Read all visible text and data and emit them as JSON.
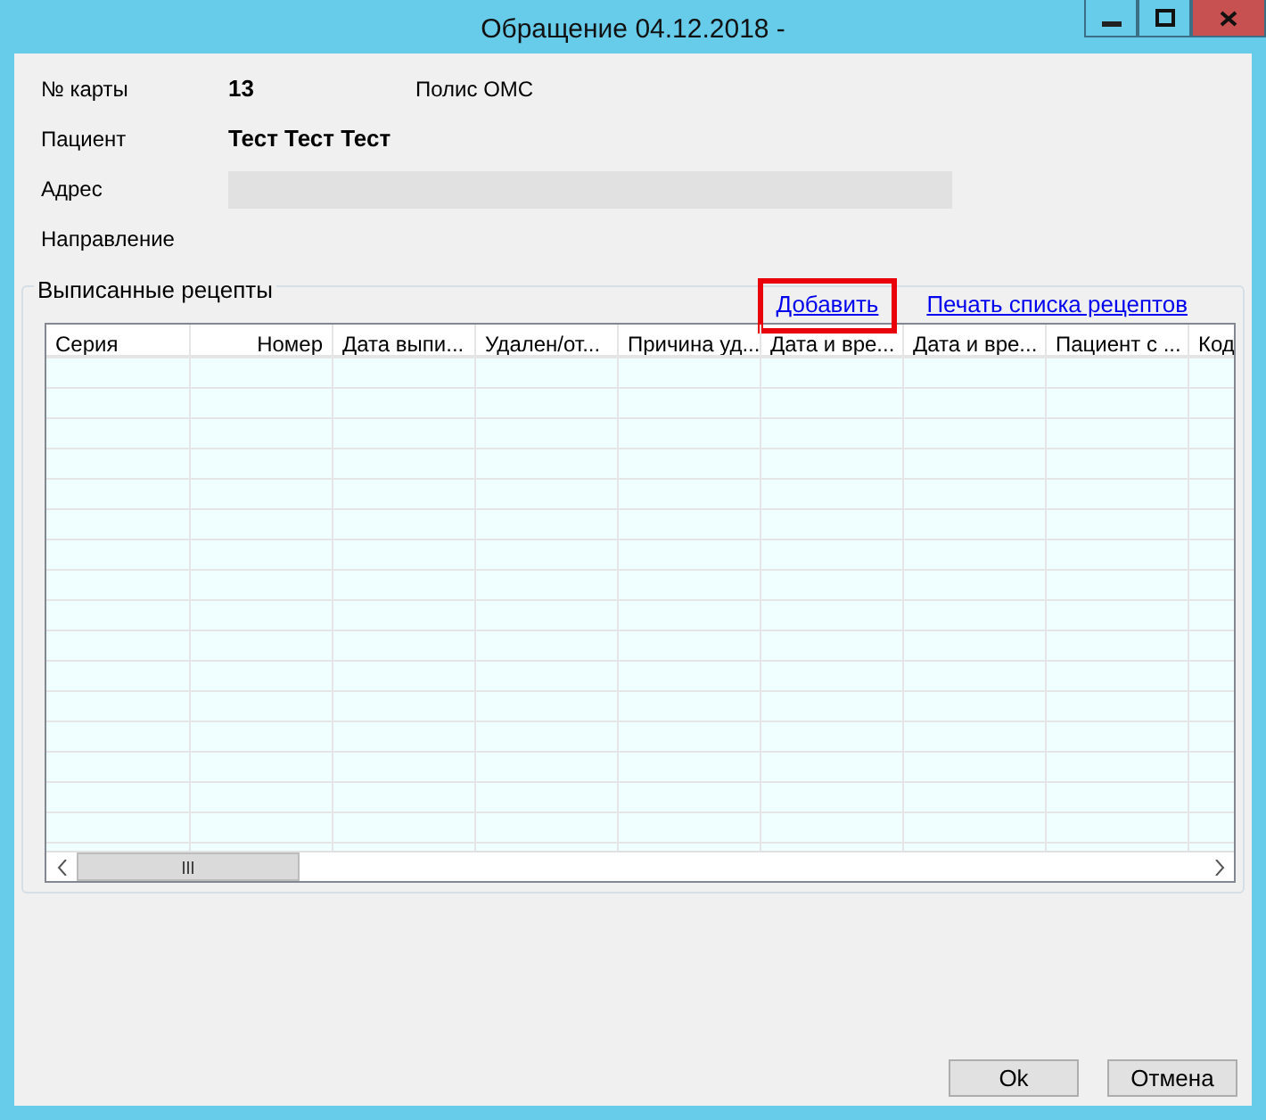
{
  "window": {
    "title": "Обращение 04.12.2018 -"
  },
  "fields": [
    {
      "label": "№ карты",
      "value": "13",
      "extra": "Полис ОМС",
      "kind": "text"
    },
    {
      "label": "Пациент",
      "value": "Тест Тест Тест",
      "kind": "text"
    },
    {
      "label": "Адрес",
      "kind": "input"
    },
    {
      "label": "Направление",
      "kind": "none"
    }
  ],
  "group": {
    "title": "Выписанные рецепты",
    "links": [
      {
        "label": "Добавить",
        "highlighted": true
      },
      {
        "label": "Печать списка рецептов",
        "highlighted": false
      }
    ],
    "table": {
      "columns": [
        {
          "label": "Серия",
          "kind": "text"
        },
        {
          "label": "Номер",
          "kind": "number"
        },
        {
          "label": "Дата выпи...",
          "kind": "text"
        },
        {
          "label": "Удален/от...",
          "kind": "text"
        },
        {
          "label": "Причина уд...",
          "kind": "text"
        },
        {
          "label": "Дата и вре...",
          "kind": "text"
        },
        {
          "label": "Дата и вре...",
          "kind": "text"
        },
        {
          "label": "Пациент с ...",
          "kind": "text"
        },
        {
          "label": "Код",
          "kind": "text"
        }
      ]
    }
  },
  "buttons": [
    "Ok",
    "Отмена"
  ]
}
